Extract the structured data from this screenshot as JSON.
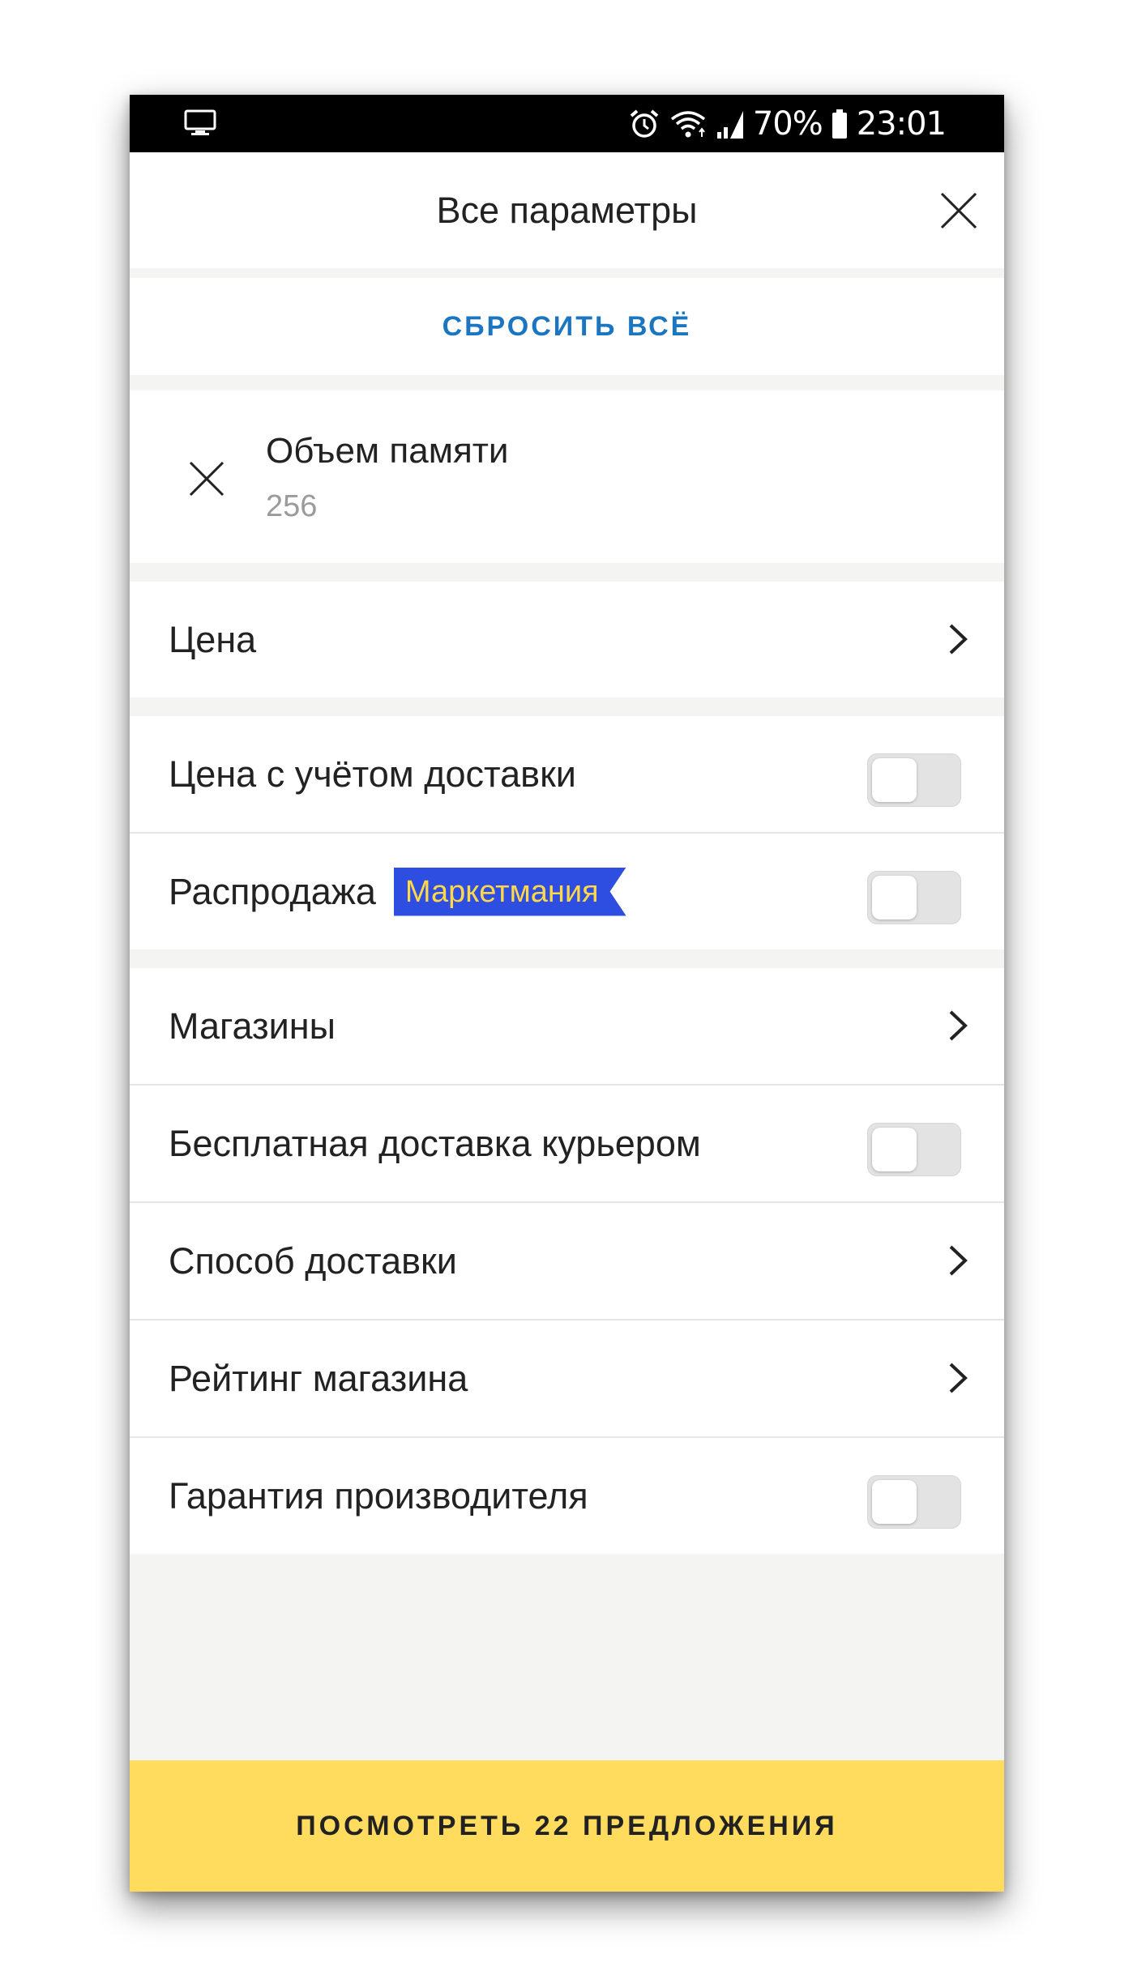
{
  "status_bar": {
    "left_icon": "screen-mirror-icon",
    "battery_percent": "70%",
    "time": "23:01",
    "icons": [
      "alarm-icon",
      "wifi-icon",
      "signal-icon",
      "battery-icon"
    ]
  },
  "header": {
    "title": "Все параметры",
    "close_icon": "close-icon"
  },
  "reset_label": "СБРОСИТЬ ВСЁ",
  "active_filter": {
    "label": "Объем памяти",
    "value": "256"
  },
  "filters": {
    "price": {
      "label": "Цена",
      "control": "chevron"
    },
    "price_with_delivery": {
      "label": "Цена с учётом доставки",
      "control": "toggle",
      "on": false
    },
    "sale": {
      "label": "Распродажа",
      "badge": "Маркетмания",
      "control": "toggle",
      "on": false
    },
    "shops": {
      "label": "Магазины",
      "control": "chevron"
    },
    "free_courier": {
      "label": "Бесплатная доставка курьером",
      "control": "toggle",
      "on": false
    },
    "delivery_method": {
      "label": "Способ доставки",
      "control": "chevron"
    },
    "shop_rating": {
      "label": "Рейтинг магазина",
      "control": "chevron"
    },
    "warranty": {
      "label": "Гарантия производителя",
      "control": "toggle",
      "on": false
    }
  },
  "footer": {
    "button_label": "ПОСМОТРЕТЬ 22 ПРЕДЛОЖЕНИЯ"
  },
  "colors": {
    "accent_link": "#1b76c2",
    "footer_button": "#ffdb5e",
    "badge_bg": "#2d4ee0",
    "badge_text": "#ffd84a"
  }
}
